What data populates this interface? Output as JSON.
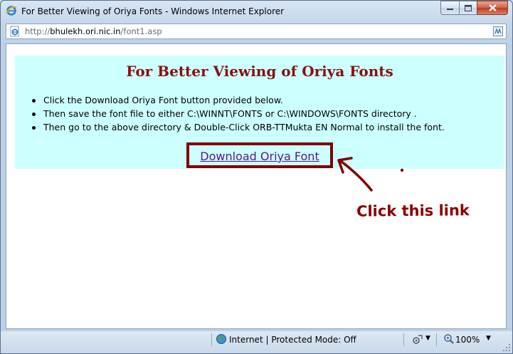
{
  "window": {
    "title": "For Better Viewing of Oriya Fonts - Windows Internet Explorer"
  },
  "address_bar": {
    "url_prefix": "http://",
    "url_host": "bhulekh.ori.nic.in",
    "url_path": "/font1.asp"
  },
  "page": {
    "heading": "For Better Viewing of Oriya Fonts",
    "instructions": [
      "Click the Download Oriya Font button provided below.",
      "Then save the font file to either C:\\WINNT\\FONTS or C:\\WINDOWS\\FONTS directory .",
      "Then go to the above directory & Double-Click ORB-TTMukta EN Normal to install the font."
    ],
    "download_link_label": "Download Oriya Font",
    "annotation_label": "Click this link",
    "panel_background": "#ccffff",
    "heading_color": "#8b1010",
    "highlight_color": "#800000"
  },
  "status_bar": {
    "zone": "Internet | Protected Mode: Off",
    "zoom": "100%"
  },
  "icons": {
    "title": "ie-logo-icon",
    "address": "ie-page-icon",
    "compat": "compatibility-view-icon",
    "zone": "globe-icon",
    "settings": "protected-mode-settings-icon",
    "zoom": "zoom-icon"
  }
}
